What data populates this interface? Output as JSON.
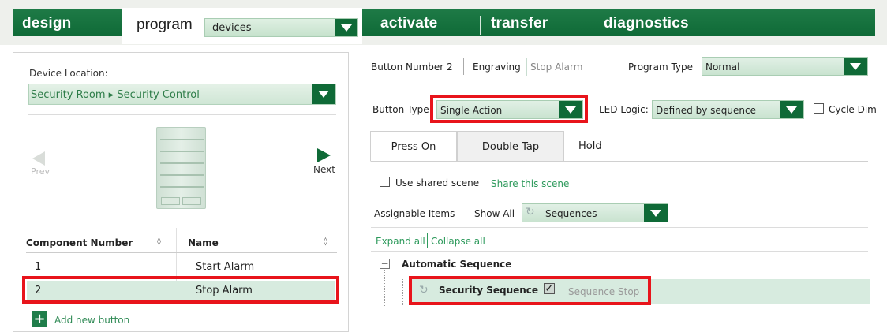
{
  "nav": {
    "design": "design",
    "program": "program",
    "devices": "devices",
    "activate": "activate",
    "transfer": "transfer",
    "diagnostics": "diagnostics"
  },
  "left": {
    "device_location_label": "Device Location:",
    "location_value": "Security Room ▸ Security Control",
    "prev": "Prev",
    "next": "Next",
    "columns": [
      "Component Number",
      "Name"
    ],
    "rows": [
      {
        "number": "1",
        "name": "Start Alarm"
      },
      {
        "number": "2",
        "name": "Stop Alarm",
        "selected": true
      }
    ],
    "add_button": "Add new button"
  },
  "right": {
    "button_number": "Button Number 2",
    "engraving_label": "Engraving",
    "engraving_value": "Stop Alarm",
    "program_type_label": "Program Type",
    "program_type_value": "Normal",
    "button_type_label": "Button Type:",
    "button_type_value": "Single Action",
    "led_logic_label": "LED Logic:",
    "led_logic_value": "Defined by sequence",
    "cycle_dim": "Cycle Dim",
    "tabs": [
      "Press On",
      "Double Tap",
      "Hold"
    ],
    "use_shared_scene": "Use shared scene",
    "share_this_scene": "Share this scene",
    "assignable_items": "Assignable Items",
    "show_all": "Show All",
    "sequences": "Sequences",
    "expand_all": "Expand all",
    "collapse_all": "Collapse all",
    "tree_group": "Automatic Sequence",
    "tree_item": "Security Sequence",
    "tree_item_action": "Sequence Stop"
  },
  "colors": {
    "brand_green": "#0f6a37",
    "highlight_red": "#e8141b",
    "selection": "#d7ebdf"
  }
}
